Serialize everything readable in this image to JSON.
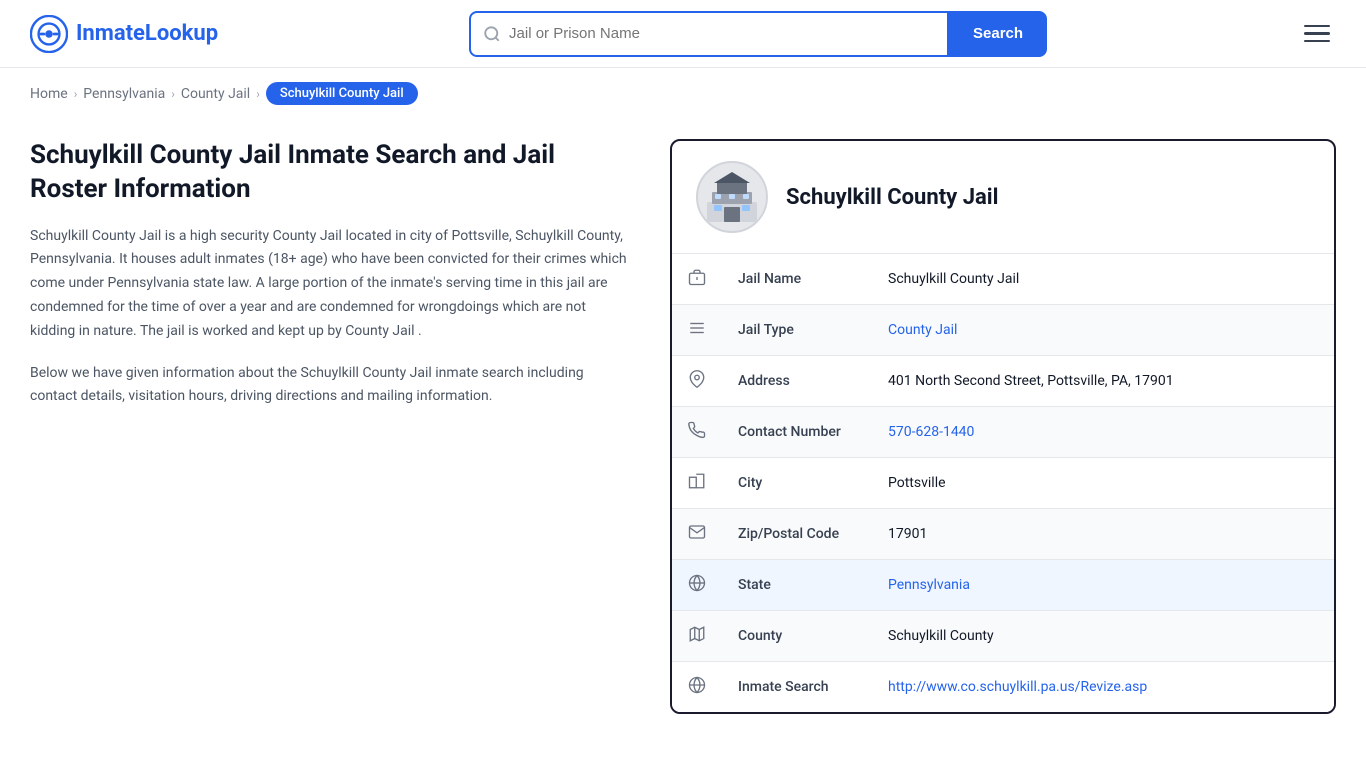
{
  "header": {
    "logo_text_part1": "Inmate",
    "logo_text_part2": "Lookup",
    "search_placeholder": "Jail or Prison Name",
    "search_button_label": "Search"
  },
  "breadcrumb": {
    "items": [
      {
        "label": "Home",
        "href": "#"
      },
      {
        "label": "Pennsylvania",
        "href": "#"
      },
      {
        "label": "County Jail",
        "href": "#"
      },
      {
        "label": "Schuylkill County Jail",
        "active": true
      }
    ]
  },
  "left": {
    "title": "Schuylkill County Jail Inmate Search and Jail Roster Information",
    "desc1": "Schuylkill County Jail is a high security County Jail located in city of Pottsville, Schuylkill County, Pennsylvania. It houses adult inmates (18+ age) who have been convicted for their crimes which come under Pennsylvania state law. A large portion of the inmate's serving time in this jail are condemned for the time of over a year and are condemned for wrongdoings which are not kidding in nature. The jail is worked and kept up by County Jail .",
    "desc2": "Below we have given information about the Schuylkill County Jail inmate search including contact details, visitation hours, driving directions and mailing information."
  },
  "card": {
    "title": "Schuylkill County Jail",
    "rows": [
      {
        "icon": "jail-icon",
        "icon_char": "🏛",
        "label": "Jail Name",
        "value": "Schuylkill County Jail",
        "link": null
      },
      {
        "icon": "type-icon",
        "icon_char": "≡",
        "label": "Jail Type",
        "value": "County Jail",
        "link": "#"
      },
      {
        "icon": "address-icon",
        "icon_char": "📍",
        "label": "Address",
        "value": "401 North Second Street, Pottsville, PA, 17901",
        "link": null
      },
      {
        "icon": "phone-icon",
        "icon_char": "📞",
        "label": "Contact Number",
        "value": "570-628-1440",
        "link": "tel:570-628-1440"
      },
      {
        "icon": "city-icon",
        "icon_char": "🏙",
        "label": "City",
        "value": "Pottsville",
        "link": null
      },
      {
        "icon": "zip-icon",
        "icon_char": "✉",
        "label": "Zip/Postal Code",
        "value": "17901",
        "link": null
      },
      {
        "icon": "state-icon",
        "icon_char": "🌐",
        "label": "State",
        "value": "Pennsylvania",
        "link": "#",
        "highlight": true
      },
      {
        "icon": "county-icon",
        "icon_char": "🗺",
        "label": "County",
        "value": "Schuylkill County",
        "link": null
      },
      {
        "icon": "search-globe-icon",
        "icon_char": "🌐",
        "label": "Inmate Search",
        "value": "http://www.co.schuylkill.pa.us/Revize.asp",
        "link": "http://www.co.schuylkill.pa.us/Revize.asp"
      }
    ]
  },
  "colors": {
    "brand": "#2563eb",
    "dark": "#1a1a2e"
  }
}
